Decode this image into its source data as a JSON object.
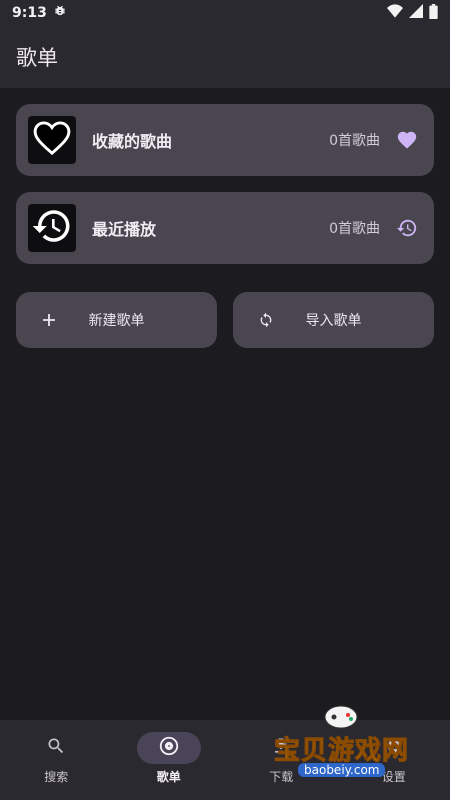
{
  "status_bar": {
    "time": "9:13",
    "notification_icon": "debug-bug-icon",
    "wifi_icon": "wifi-icon",
    "signal_icon": "signal-icon",
    "battery_icon": "battery-icon"
  },
  "app_bar": {
    "title": "歌单"
  },
  "cards": {
    "favorites": {
      "title": "收藏的歌曲",
      "count": "0首歌曲",
      "thumb_icon": "heart-icon",
      "action_icon": "heart-icon"
    },
    "recent": {
      "title": "最近播放",
      "count": "0首歌曲",
      "thumb_icon": "history-icon",
      "action_icon": "history-icon"
    }
  },
  "buttons": {
    "new_playlist": "新建歌单",
    "import_playlist": "导入歌单"
  },
  "bottom_nav": {
    "items": [
      {
        "label": "搜索",
        "icon": "search-icon"
      },
      {
        "label": "歌单",
        "icon": "album-icon",
        "active": true
      },
      {
        "label": "下载",
        "icon": "download-icon"
      },
      {
        "label": "设置",
        "icon": "settings-icon"
      }
    ]
  },
  "watermark": {
    "text": "宝贝游戏网",
    "url": "baobeiy.com"
  },
  "colors": {
    "background": "#1c1b1f",
    "surface": "#2b2930",
    "card": "#4a4650",
    "accent": "#cdb5f5",
    "nav_indicator": "#4a4458"
  }
}
